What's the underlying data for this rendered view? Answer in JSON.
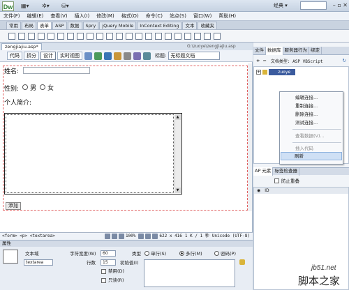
{
  "app": {
    "logo": "Dw",
    "workspace": "经典 ▾",
    "window_controls": "– ▫ ✕"
  },
  "menu": [
    "文件(F)",
    "编辑(E)",
    "查看(V)",
    "插入(I)",
    "修改(M)",
    "格式(O)",
    "命令(C)",
    "站点(S)",
    "窗口(W)",
    "帮助(H)"
  ],
  "insert_tabs": [
    "常用",
    "布局",
    "表单",
    "ASP",
    "数据",
    "Spry",
    "jQuery Mobile",
    "InContext Editing",
    "文本",
    "收藏夹"
  ],
  "insert_active": 2,
  "document": {
    "tab": "zengjiajiu.asp*",
    "path": "G:\\zuoye\\zengjiajiu.asp",
    "views": [
      "代码",
      "拆分",
      "设计",
      "实时视图"
    ],
    "active_view": 2,
    "title_label": "标题:",
    "title_value": "无标题文档"
  },
  "form": {
    "name_label": "姓名:",
    "gender_label": "性别:",
    "male": "男",
    "female": "女",
    "intro_label": "个人简介:",
    "submit_label": "添加"
  },
  "status": {
    "tag_path": "<form> <p> <textarea>",
    "zoom": "100%",
    "size": "622 x 416",
    "weight": "1 K / 1 秒",
    "encoding": "Unicode (UTF-8)"
  },
  "properties": {
    "header": "属性",
    "type_name": "文本域",
    "field_name": "textarea",
    "char_width_label": "字符宽度(W)",
    "char_width": "60",
    "rows_label": "行数",
    "rows": "15",
    "type_label": "类型",
    "single": "单行(S)",
    "multi": "多行(M)",
    "password": "密码(P)",
    "init_label": "初始值(I)",
    "disabled": "禁用(D)",
    "readonly": "只读(R)"
  },
  "right_panel": {
    "tabs": [
      "文件",
      "数据库",
      "服务器行为",
      "绑定"
    ],
    "active_tab": 1,
    "doc_type": "文档类型: ASP VBScript",
    "node": "zuoye",
    "context_menu": [
      "编辑连接...",
      "重制连接...",
      "删除连接...",
      "测试连接...",
      "查看数据(V)...",
      "插入代码",
      "刷新"
    ],
    "highlight": "刷新",
    "ap_tabs": [
      "AP 元素",
      "标签检查器"
    ],
    "prevent_overlap": "防止重叠",
    "ap_id_col": "ID"
  },
  "watermark": {
    "line1": "jb51.net",
    "line2": "脚本之家"
  }
}
